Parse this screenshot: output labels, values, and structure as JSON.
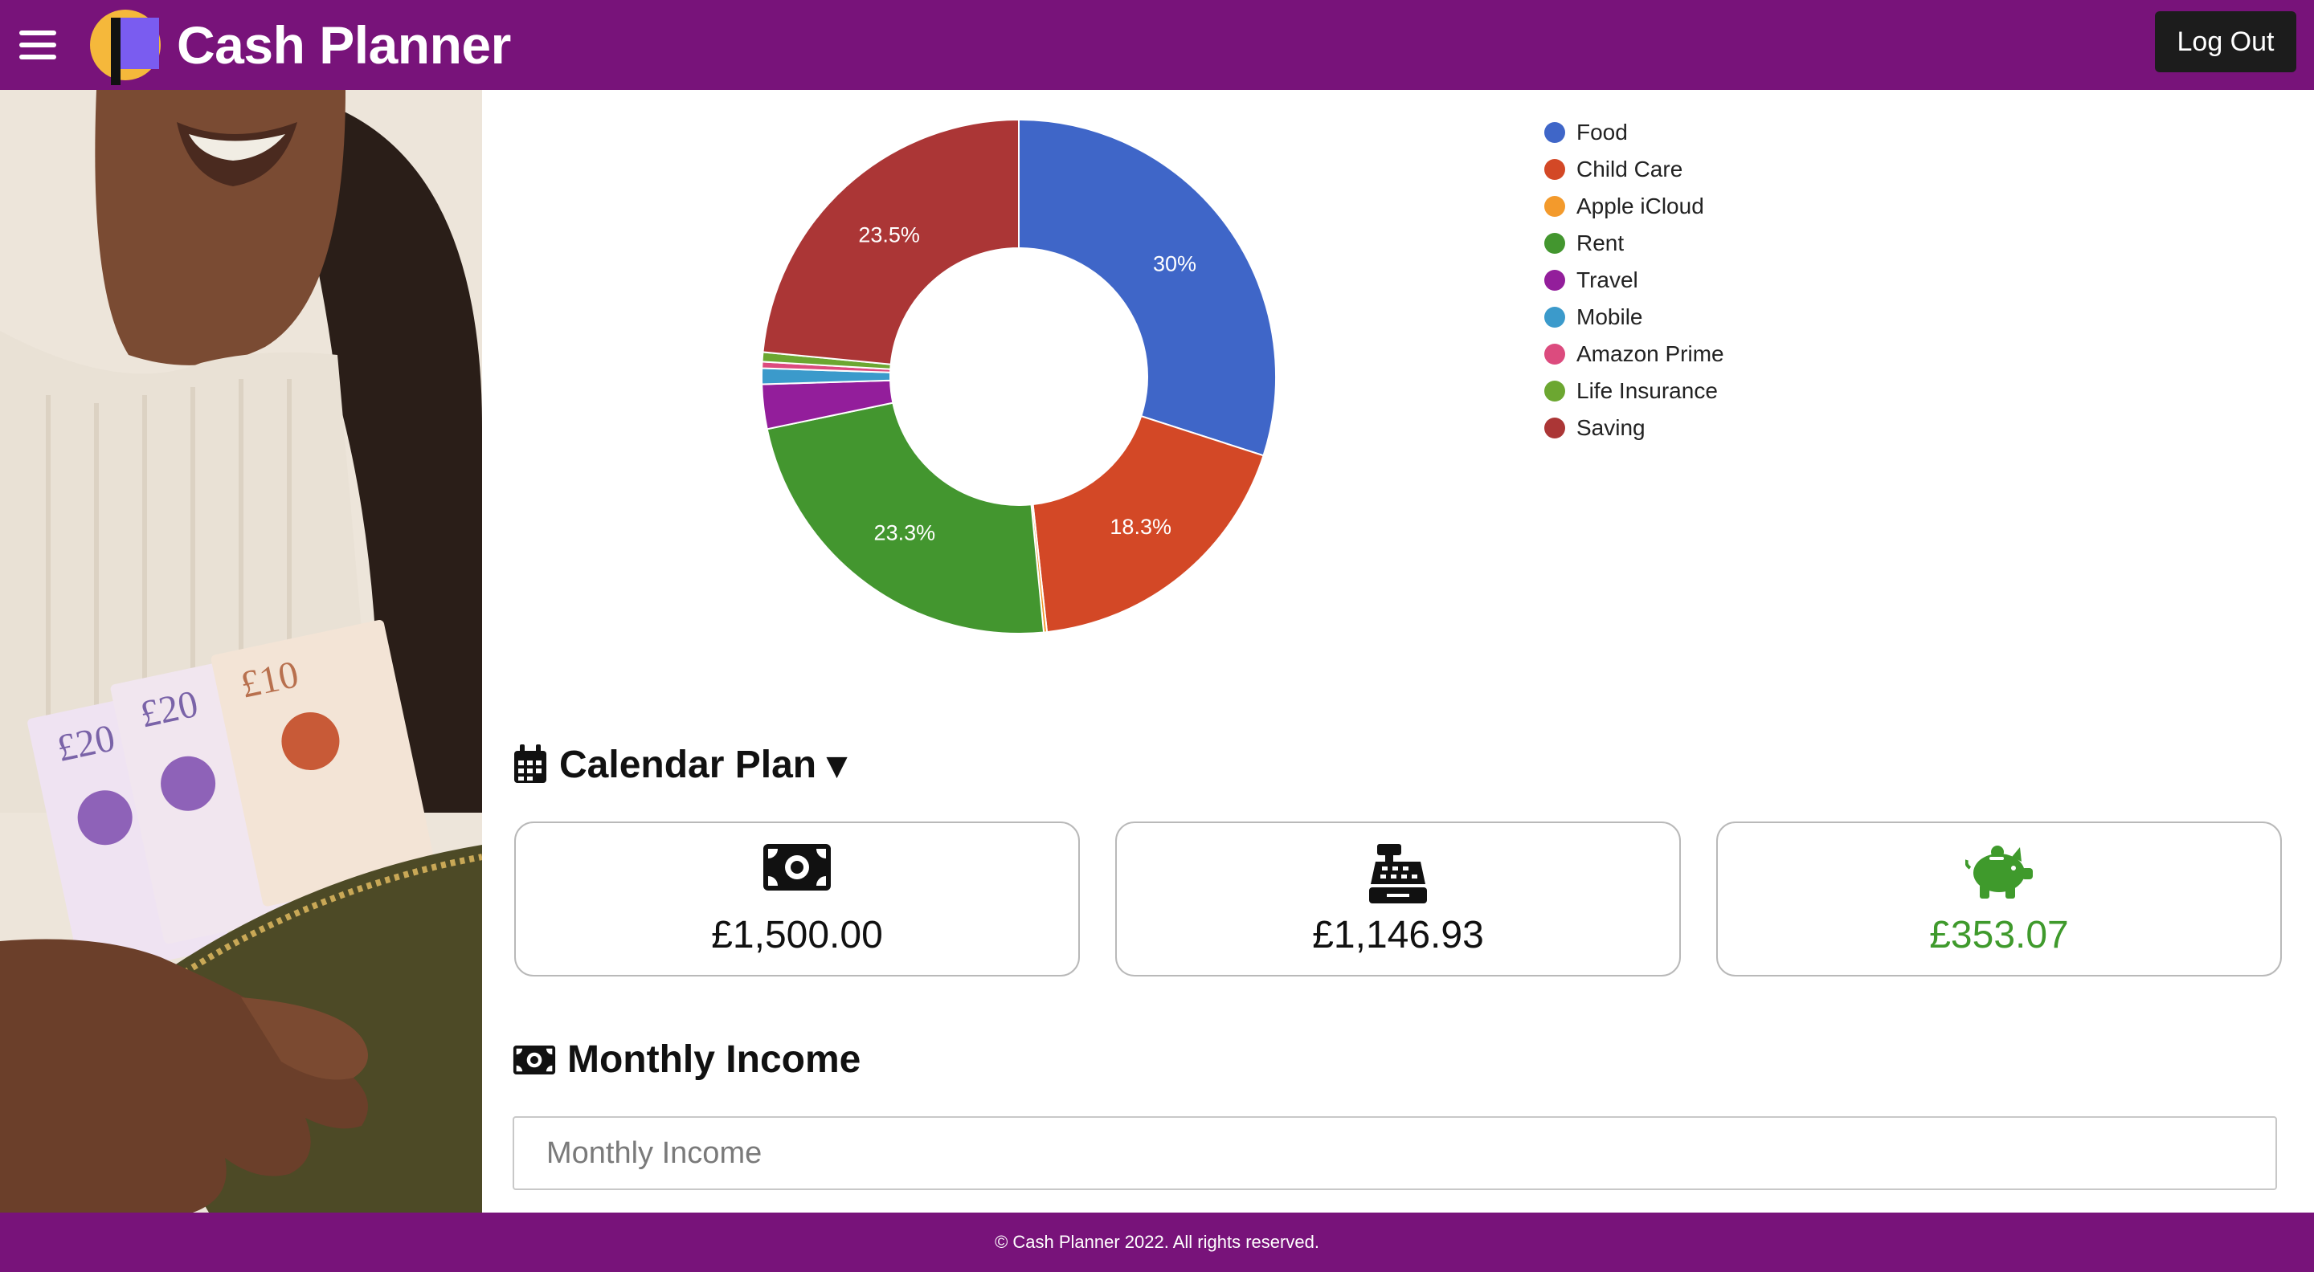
{
  "header": {
    "title": "Cash Planner",
    "logout_label": "Log Out",
    "bg_color": "#78137a"
  },
  "chart_data": {
    "type": "pie",
    "subtype": "donut",
    "slices": [
      {
        "label": "Food",
        "value": 30.0,
        "color": "#3f66c8",
        "data_label": "30%"
      },
      {
        "label": "Child Care",
        "value": 18.3,
        "color": "#d34826",
        "data_label": "18.3%"
      },
      {
        "label": "Apple iCloud",
        "value": 0.2,
        "color": "#f39a2c",
        "data_label": ""
      },
      {
        "label": "Rent",
        "value": 23.3,
        "color": "#43962f",
        "data_label": "23.3%"
      },
      {
        "label": "Travel",
        "value": 2.8,
        "color": "#931e9b",
        "data_label": ""
      },
      {
        "label": "Mobile",
        "value": 1.0,
        "color": "#3b9acb",
        "data_label": ""
      },
      {
        "label": "Amazon Prime",
        "value": 0.4,
        "color": "#dc4b7e",
        "data_label": ""
      },
      {
        "label": "Life Insurance",
        "value": 0.6,
        "color": "#6ca731",
        "data_label": ""
      },
      {
        "label": "Saving",
        "value": 23.5,
        "color": "#ab3636",
        "data_label": "23.5%"
      }
    ],
    "legend_position": "right"
  },
  "calendar_plan": {
    "title": "Calendar Plan ▾",
    "cards": [
      {
        "icon": "money-bill-icon",
        "value": "£1,500.00",
        "color": "#111111"
      },
      {
        "icon": "cash-register-icon",
        "value": "£1,146.93",
        "color": "#111111"
      },
      {
        "icon": "piggy-bank-icon",
        "value": "£353.07",
        "color": "#3f9a2c"
      }
    ]
  },
  "monthly_income": {
    "title": "Monthly Income",
    "placeholder": "Monthly Income"
  },
  "footer": {
    "text": "© Cash Planner 2022. All rights reserved."
  }
}
